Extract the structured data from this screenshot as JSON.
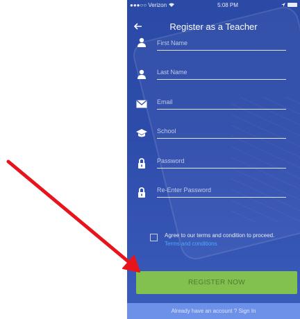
{
  "status_bar": {
    "carrier": "●●●○○ Verizon",
    "wifi": "wifi-icon",
    "time": "5:08 PM",
    "location": "location-arrow-icon",
    "battery": "battery-icon"
  },
  "header": {
    "title": "Register as a Teacher",
    "back_icon": "back-arrow-icon"
  },
  "form": {
    "first_name": {
      "placeholder": "First Name",
      "icon": "person-icon"
    },
    "last_name": {
      "placeholder": "Last Name",
      "icon": "person-icon"
    },
    "email": {
      "placeholder": "Email",
      "icon": "envelope-icon"
    },
    "school": {
      "placeholder": "School",
      "icon": "graduation-cap-icon"
    },
    "password": {
      "placeholder": "Password",
      "icon": "lock-icon"
    },
    "reenter_password": {
      "placeholder": "Re-Enter Password",
      "icon": "lock-icon"
    }
  },
  "agree": {
    "text": "Agree to our terms and condition to proceed.",
    "link": "Terms and conditions",
    "checked": false
  },
  "register_button": {
    "label": "REGISTER NOW"
  },
  "footer": {
    "text": "Already have an account ? Sign In"
  },
  "colors": {
    "background": "#2d4caa",
    "button": "#82c04f",
    "footer": "#6d90e8",
    "link": "#49a9ff",
    "annotation_arrow": "#e8141c"
  }
}
